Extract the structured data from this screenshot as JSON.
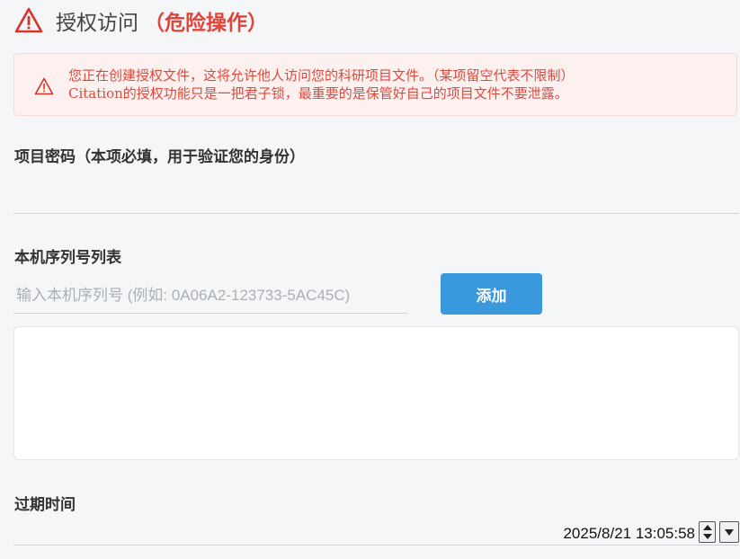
{
  "header": {
    "title": "授权访问",
    "danger_label": "（危险操作）",
    "danger_color": "#e0453a"
  },
  "alert": {
    "icon": "warning-triangle-icon",
    "line1": "您正在创建授权文件，这将允许他人访问您的科研项目文件。（某项留空代表不限制）",
    "line2": "Citation的授权功能只是一把君子锁，最重要的是保管好自己的项目文件不要泄露。"
  },
  "password": {
    "label": "项目密码（本项必填，用于验证您的身份）",
    "value": ""
  },
  "serials": {
    "label": "本机序列号列表",
    "placeholder": "输入本机序列号 (例如: 0A06A2-123733-5AC45C)",
    "add_button": "添加",
    "items": []
  },
  "expiry": {
    "label": "过期时间",
    "value": "2025/8/21 13:05:58"
  },
  "colors": {
    "accent": "#3a98dc",
    "alert_bg": "#fdf1f0",
    "alert_text": "#dc4a3e"
  }
}
